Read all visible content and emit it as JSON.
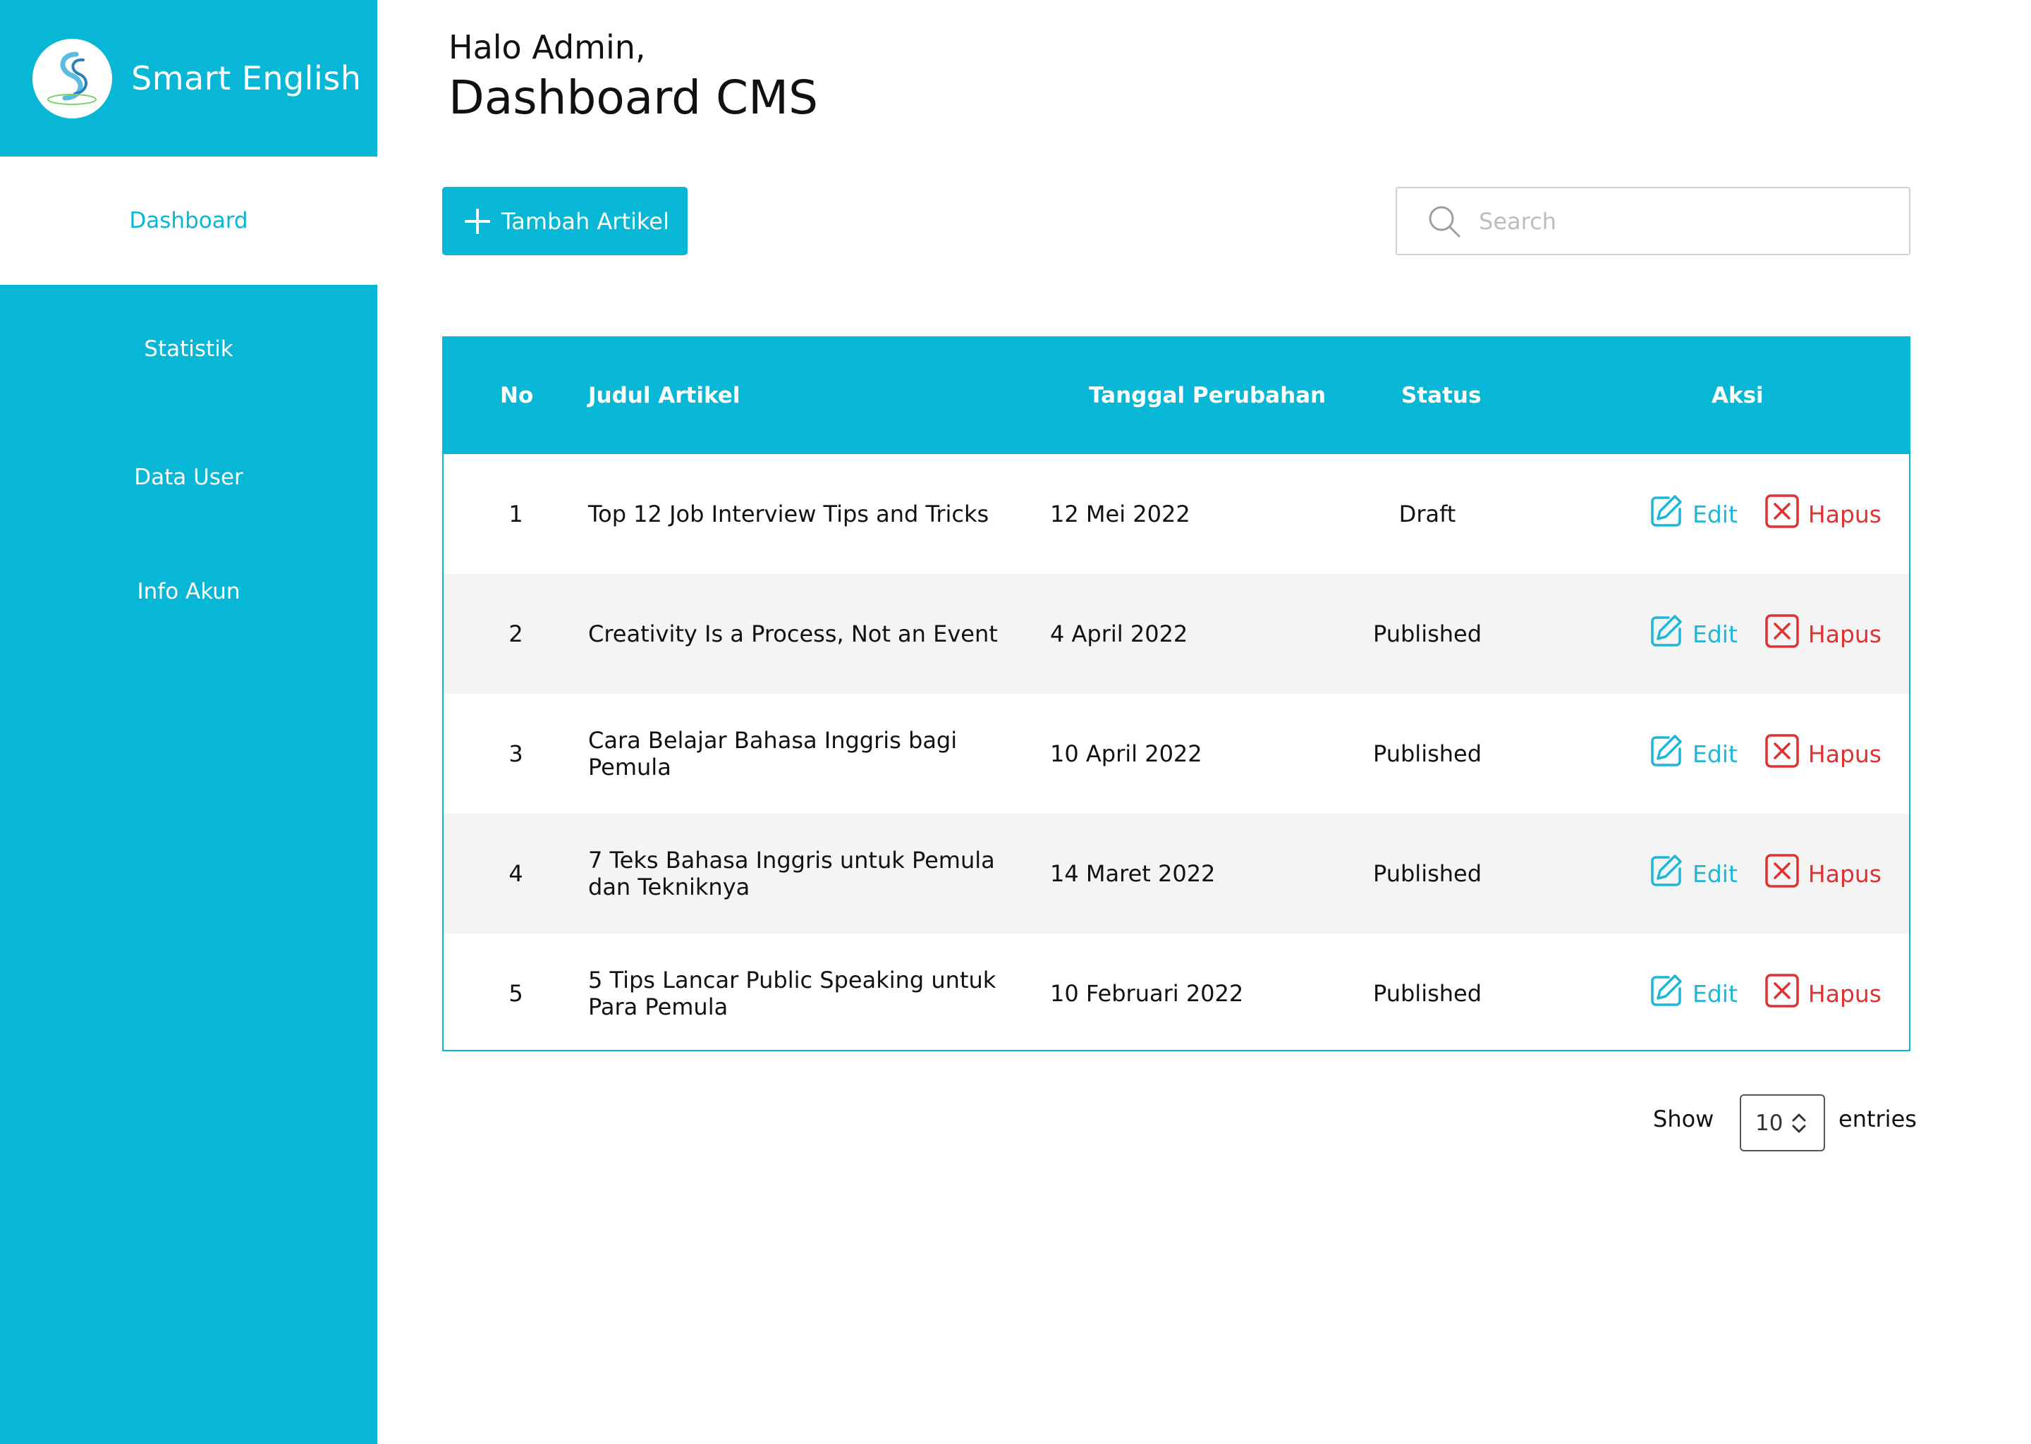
{
  "brand": {
    "name": "Smart English",
    "logo_icon": "smart-english-logo"
  },
  "sidebar": {
    "items": [
      {
        "label": "Dashboard",
        "active": true
      },
      {
        "label": "Statistik"
      },
      {
        "label": "Data User"
      },
      {
        "label": "Info Akun"
      }
    ]
  },
  "header": {
    "greeting": "Halo Admin,",
    "title": "Dashboard CMS"
  },
  "toolbar": {
    "add_label": "Tambah Artikel",
    "search_placeholder": "Search"
  },
  "table": {
    "columns": [
      "No",
      "Judul Artikel",
      "Tanggal Perubahan",
      "Status",
      "Aksi"
    ],
    "rows": [
      {
        "no": "1",
        "title": "Top 12 Job Interview Tips and Tricks",
        "date": "12 Mei 2022",
        "status": "Draft"
      },
      {
        "no": "2",
        "title": "Creativity Is a Process, Not an Event",
        "date": "4 April 2022",
        "status": "Published"
      },
      {
        "no": "3",
        "title": "Cara Belajar Bahasa Inggris bagi Pemula",
        "date": "10 April 2022",
        "status": "Published"
      },
      {
        "no": "4",
        "title": "7 Teks Bahasa Inggris untuk Pemula dan Tekniknya",
        "date": "14 Maret 2022",
        "status": "Published"
      },
      {
        "no": "5",
        "title": "5 Tips Lancar Public Speaking untuk Para Pemula",
        "date": "10 Februari 2022",
        "status": "Published"
      }
    ],
    "edit_label": "Edit",
    "delete_label": "Hapus"
  },
  "footer": {
    "show_label": "Show",
    "entries_value": "10",
    "entries_label": "entries"
  },
  "colors": {
    "accent": "#08b6d6",
    "edit": "#1fb6d8",
    "delete": "#e03131",
    "alt_row": "#f4f4f4"
  }
}
